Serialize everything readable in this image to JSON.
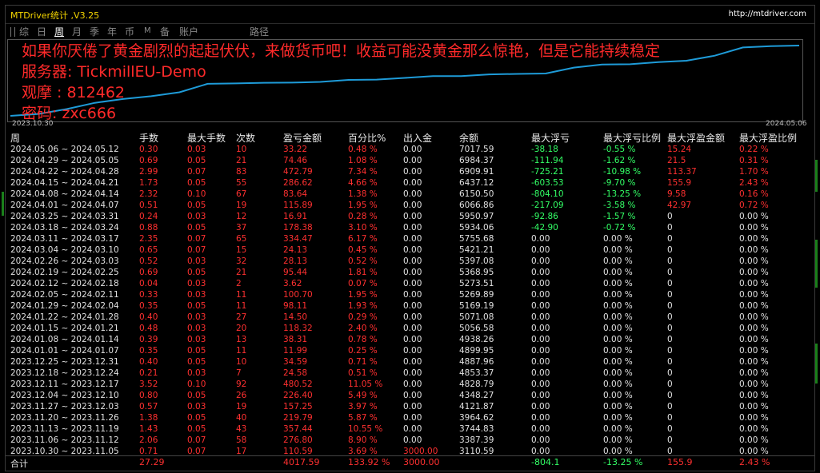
{
  "window": {
    "title": "MTDriver统计 ,V3.25",
    "site": "http://mtdriver.com"
  },
  "tabs": [
    {
      "label": "综",
      "active": false
    },
    {
      "label": "日",
      "active": false
    },
    {
      "label": "周",
      "active": true
    },
    {
      "label": "月",
      "active": false
    },
    {
      "label": "季",
      "active": false
    },
    {
      "label": "年",
      "active": false
    },
    {
      "label": "币",
      "active": false
    },
    {
      "label": "M",
      "active": false
    },
    {
      "label": "备",
      "active": false
    },
    {
      "label": "账户",
      "active": false
    },
    {
      "label": "路径",
      "active": false
    }
  ],
  "overlay": {
    "line1": "如果你厌倦了黄金剧烈的起起伏伏，来做货币吧！收益可能没黄金那么惊艳，但是它能持续稳定",
    "line2": "服务器: TickmillEU-Demo",
    "line3": "观摩 : 812462",
    "line4": "密码: zxc666"
  },
  "chart": {
    "date_start": "2023.10.30",
    "date_end": "2024.05.06",
    "line_color": "#1e9bd8",
    "balance_series": [
      3000,
      3110.59,
      3387.39,
      3744.83,
      3964.62,
      4121.87,
      4348.27,
      4828.79,
      4853.37,
      4887.96,
      4899.95,
      4938.26,
      5056.58,
      5071.08,
      5169.19,
      5269.89,
      5273.51,
      5368.95,
      5397.08,
      5421.21,
      5755.68,
      5934.06,
      5950.97,
      6066.86,
      6150.5,
      6437.12,
      6909.91,
      6984.37,
      7017.59
    ]
  },
  "columns": [
    "周",
    "手数",
    "最大手数",
    "次数",
    "盈亏金额",
    "百分比%",
    "出入金",
    "余额",
    "最大浮亏",
    "最大浮亏比例",
    "最大浮盈金额",
    "最大浮盈比例"
  ],
  "rows": [
    {
      "week": "2024.05.06 ~ 2024.05.12",
      "lots": "0.30",
      "maxlot": "0.03",
      "cnt": "10",
      "pl": "33.22",
      "pct": "0.48 %",
      "io": "0.00",
      "bal": "7017.59",
      "mdd": "-38.18",
      "mddp": "-0.55 %",
      "mfp": "15.24",
      "mfpp": "0.22 %"
    },
    {
      "week": "2024.04.29 ~ 2024.05.05",
      "lots": "0.69",
      "maxlot": "0.05",
      "cnt": "21",
      "pl": "74.46",
      "pct": "1.08 %",
      "io": "0.00",
      "bal": "6984.37",
      "mdd": "-111.94",
      "mddp": "-1.62 %",
      "mfp": "21.5",
      "mfpp": "0.31 %"
    },
    {
      "week": "2024.04.22 ~ 2024.04.28",
      "lots": "2.99",
      "maxlot": "0.07",
      "cnt": "83",
      "pl": "472.79",
      "pct": "7.34 %",
      "io": "0.00",
      "bal": "6909.91",
      "mdd": "-725.21",
      "mddp": "-10.98 %",
      "mfp": "113.37",
      "mfpp": "1.70 %"
    },
    {
      "week": "2024.04.15 ~ 2024.04.21",
      "lots": "1.73",
      "maxlot": "0.05",
      "cnt": "55",
      "pl": "286.62",
      "pct": "4.66 %",
      "io": "0.00",
      "bal": "6437.12",
      "mdd": "-603.53",
      "mddp": "-9.70 %",
      "mfp": "155.9",
      "mfpp": "2.43 %"
    },
    {
      "week": "2024.04.08 ~ 2024.04.14",
      "lots": "2.32",
      "maxlot": "0.10",
      "cnt": "67",
      "pl": "83.64",
      "pct": "1.38 %",
      "io": "0.00",
      "bal": "6150.50",
      "mdd": "-804.10",
      "mddp": "-13.25 %",
      "mfp": "9.58",
      "mfpp": "0.16 %"
    },
    {
      "week": "2024.04.01 ~ 2024.04.07",
      "lots": "0.51",
      "maxlot": "0.05",
      "cnt": "19",
      "pl": "115.89",
      "pct": "1.95 %",
      "io": "0.00",
      "bal": "6066.86",
      "mdd": "-217.09",
      "mddp": "-3.58 %",
      "mfp": "42.97",
      "mfpp": "0.72 %"
    },
    {
      "week": "2024.03.25 ~ 2024.03.31",
      "lots": "0.24",
      "maxlot": "0.03",
      "cnt": "12",
      "pl": "16.91",
      "pct": "0.28 %",
      "io": "0.00",
      "bal": "5950.97",
      "mdd": "-92.86",
      "mddp": "-1.57 %",
      "mfp": "0",
      "mfpp": "0.00 %"
    },
    {
      "week": "2024.03.18 ~ 2024.03.24",
      "lots": "0.88",
      "maxlot": "0.05",
      "cnt": "37",
      "pl": "178.38",
      "pct": "3.10 %",
      "io": "0.00",
      "bal": "5934.06",
      "mdd": "-42.90",
      "mddp": "-0.72 %",
      "mfp": "0",
      "mfpp": "0.00 %"
    },
    {
      "week": "2024.03.11 ~ 2024.03.17",
      "lots": "2.35",
      "maxlot": "0.07",
      "cnt": "65",
      "pl": "334.47",
      "pct": "6.17 %",
      "io": "0.00",
      "bal": "5755.68",
      "mdd": "0.00",
      "mddp": "0.00 %",
      "mfp": "0",
      "mfpp": "0.00 %"
    },
    {
      "week": "2024.03.04 ~ 2024.03.10",
      "lots": "0.65",
      "maxlot": "0.07",
      "cnt": "15",
      "pl": "24.13",
      "pct": "0.45 %",
      "io": "0.00",
      "bal": "5421.21",
      "mdd": "0.00",
      "mddp": "0.00 %",
      "mfp": "0",
      "mfpp": "0.00 %"
    },
    {
      "week": "2024.02.26 ~ 2024.03.03",
      "lots": "0.52",
      "maxlot": "0.03",
      "cnt": "32",
      "pl": "28.13",
      "pct": "0.52 %",
      "io": "0.00",
      "bal": "5397.08",
      "mdd": "0.00",
      "mddp": "0.00 %",
      "mfp": "0",
      "mfpp": "0.00 %"
    },
    {
      "week": "2024.02.19 ~ 2024.02.25",
      "lots": "0.69",
      "maxlot": "0.05",
      "cnt": "21",
      "pl": "95.44",
      "pct": "1.81 %",
      "io": "0.00",
      "bal": "5368.95",
      "mdd": "0.00",
      "mddp": "0.00 %",
      "mfp": "0",
      "mfpp": "0.00 %"
    },
    {
      "week": "2024.02.12 ~ 2024.02.18",
      "lots": "0.04",
      "maxlot": "0.03",
      "cnt": "2",
      "pl": "3.62",
      "pct": "0.07 %",
      "io": "0.00",
      "bal": "5273.51",
      "mdd": "0.00",
      "mddp": "0.00 %",
      "mfp": "0",
      "mfpp": "0.00 %"
    },
    {
      "week": "2024.02.05 ~ 2024.02.11",
      "lots": "0.33",
      "maxlot": "0.03",
      "cnt": "11",
      "pl": "100.70",
      "pct": "1.95 %",
      "io": "0.00",
      "bal": "5269.89",
      "mdd": "0.00",
      "mddp": "0.00 %",
      "mfp": "0",
      "mfpp": "0.00 %"
    },
    {
      "week": "2024.01.29 ~ 2024.02.04",
      "lots": "0.35",
      "maxlot": "0.05",
      "cnt": "11",
      "pl": "98.11",
      "pct": "1.93 %",
      "io": "0.00",
      "bal": "5169.19",
      "mdd": "0.00",
      "mddp": "0.00 %",
      "mfp": "0",
      "mfpp": "0.00 %"
    },
    {
      "week": "2024.01.22 ~ 2024.01.28",
      "lots": "0.40",
      "maxlot": "0.03",
      "cnt": "27",
      "pl": "14.50",
      "pct": "0.29 %",
      "io": "0.00",
      "bal": "5071.08",
      "mdd": "0.00",
      "mddp": "0.00 %",
      "mfp": "0",
      "mfpp": "0.00 %"
    },
    {
      "week": "2024.01.15 ~ 2024.01.21",
      "lots": "0.48",
      "maxlot": "0.03",
      "cnt": "20",
      "pl": "118.32",
      "pct": "2.40 %",
      "io": "0.00",
      "bal": "5056.58",
      "mdd": "0.00",
      "mddp": "0.00 %",
      "mfp": "0",
      "mfpp": "0.00 %"
    },
    {
      "week": "2024.01.08 ~ 2024.01.14",
      "lots": "0.39",
      "maxlot": "0.03",
      "cnt": "13",
      "pl": "38.31",
      "pct": "0.78 %",
      "io": "0.00",
      "bal": "4938.26",
      "mdd": "0.00",
      "mddp": "0.00 %",
      "mfp": "0",
      "mfpp": "0.00 %"
    },
    {
      "week": "2024.01.01 ~ 2024.01.07",
      "lots": "0.35",
      "maxlot": "0.05",
      "cnt": "11",
      "pl": "11.99",
      "pct": "0.25 %",
      "io": "0.00",
      "bal": "4899.95",
      "mdd": "0.00",
      "mddp": "0.00 %",
      "mfp": "0",
      "mfpp": "0.00 %"
    },
    {
      "week": "2023.12.25 ~ 2023.12.31",
      "lots": "0.40",
      "maxlot": "0.05",
      "cnt": "10",
      "pl": "34.59",
      "pct": "0.71 %",
      "io": "0.00",
      "bal": "4887.96",
      "mdd": "0.00",
      "mddp": "0.00 %",
      "mfp": "0",
      "mfpp": "0.00 %"
    },
    {
      "week": "2023.12.18 ~ 2023.12.24",
      "lots": "0.21",
      "maxlot": "0.03",
      "cnt": "7",
      "pl": "24.58",
      "pct": "0.51 %",
      "io": "0.00",
      "bal": "4853.37",
      "mdd": "0.00",
      "mddp": "0.00 %",
      "mfp": "0",
      "mfpp": "0.00 %"
    },
    {
      "week": "2023.12.11 ~ 2023.12.17",
      "lots": "3.52",
      "maxlot": "0.10",
      "cnt": "92",
      "pl": "480.52",
      "pct": "11.05 %",
      "io": "0.00",
      "bal": "4828.79",
      "mdd": "0.00",
      "mddp": "0.00 %",
      "mfp": "0",
      "mfpp": "0.00 %"
    },
    {
      "week": "2023.12.04 ~ 2023.12.10",
      "lots": "0.80",
      "maxlot": "0.05",
      "cnt": "26",
      "pl": "226.40",
      "pct": "5.49 %",
      "io": "0.00",
      "bal": "4348.27",
      "mdd": "0.00",
      "mddp": "0.00 %",
      "mfp": "0",
      "mfpp": "0.00 %"
    },
    {
      "week": "2023.11.27 ~ 2023.12.03",
      "lots": "0.57",
      "maxlot": "0.03",
      "cnt": "19",
      "pl": "157.25",
      "pct": "3.97 %",
      "io": "0.00",
      "bal": "4121.87",
      "mdd": "0.00",
      "mddp": "0.00 %",
      "mfp": "0",
      "mfpp": "0.00 %"
    },
    {
      "week": "2023.11.20 ~ 2023.11.26",
      "lots": "1.38",
      "maxlot": "0.05",
      "cnt": "40",
      "pl": "219.79",
      "pct": "5.87 %",
      "io": "0.00",
      "bal": "3964.62",
      "mdd": "0.00",
      "mddp": "0.00 %",
      "mfp": "0",
      "mfpp": "0.00 %"
    },
    {
      "week": "2023.11.13 ~ 2023.11.19",
      "lots": "1.43",
      "maxlot": "0.05",
      "cnt": "43",
      "pl": "357.44",
      "pct": "10.55 %",
      "io": "0.00",
      "bal": "3744.83",
      "mdd": "0.00",
      "mddp": "0.00 %",
      "mfp": "0",
      "mfpp": "0.00 %"
    },
    {
      "week": "2023.11.06 ~ 2023.11.12",
      "lots": "2.06",
      "maxlot": "0.07",
      "cnt": "58",
      "pl": "276.80",
      "pct": "8.90 %",
      "io": "0.00",
      "bal": "3387.39",
      "mdd": "0.00",
      "mddp": "0.00 %",
      "mfp": "0",
      "mfpp": "0.00 %"
    },
    {
      "week": "2023.10.30 ~ 2023.11.05",
      "lots": "0.71",
      "maxlot": "0.07",
      "cnt": "17",
      "pl": "110.59",
      "pct": "3.69 %",
      "io": "3000.00",
      "bal": "3110.59",
      "mdd": "0.00",
      "mddp": "0.00 %",
      "mfp": "0",
      "mfpp": "0.00 %"
    }
  ],
  "total": {
    "label": "合计",
    "lots": "27.29",
    "pl": "4017.59",
    "pct": "133.92 %",
    "io": "3000.00",
    "mdd": "-804.1",
    "mddp": "-13.25 %",
    "mfp": "155.9",
    "mfpp": "2.43 %"
  }
}
